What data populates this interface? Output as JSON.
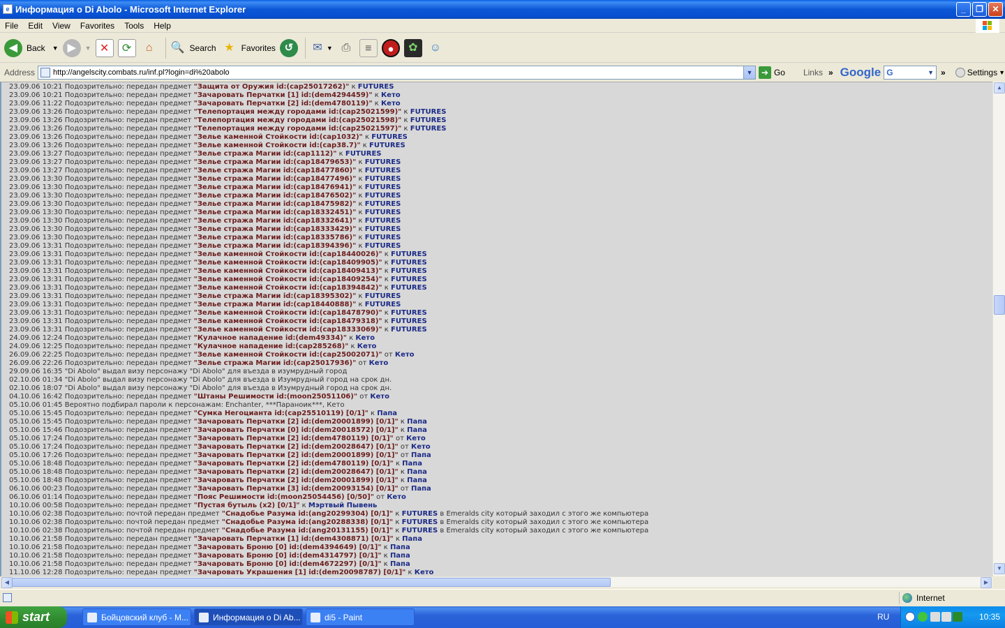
{
  "window": {
    "title": "Информация о Di Abolo - Microsoft Internet Explorer"
  },
  "menu": [
    "File",
    "Edit",
    "View",
    "Favorites",
    "Tools",
    "Help"
  ],
  "toolbar": {
    "back": "Back",
    "search": "Search",
    "favorites": "Favorites"
  },
  "address": {
    "label": "Address",
    "url": "http://angelscity.combats.ru/inf.pl?login=di%20abolo",
    "go": "Go",
    "links": "Links",
    "google": "Google",
    "settings": "Settings"
  },
  "log": [
    {
      "t": "23.09.06 10:21 Подозрительно: передан предмет ",
      "item": "Защита от Оружия id:(cap25017262)",
      "dir": " к ",
      "who": "FUTURES"
    },
    {
      "t": "23.09.06 10:21 Подозрительно: передан предмет ",
      "item": "Зачаровать Перчатки [1] id:(dem4294459)",
      "dir": " к ",
      "who": "Кето"
    },
    {
      "t": "23.09.06 11:22 Подозрительно: передан предмет ",
      "item": "Зачаровать Перчатки [2] id:(dem4780119)",
      "dir": " к ",
      "who": "Кето"
    },
    {
      "t": "23.09.06 13:26 Подозрительно: передан предмет ",
      "item": "Телепортация между городами id:(cap25021599)",
      "dir": " к ",
      "who": "FUTURES"
    },
    {
      "t": "23.09.06 13:26 Подозрительно: передан предмет ",
      "item": "Телепортация между городами id:(cap25021598)",
      "dir": " к ",
      "who": "FUTURES"
    },
    {
      "t": "23.09.06 13:26 Подозрительно: передан предмет ",
      "item": "Телепортация между городами id:(cap25021597)",
      "dir": " к ",
      "who": "FUTURES"
    },
    {
      "t": "23.09.06 13:26 Подозрительно: передан предмет ",
      "item": "Зелье каменной Стойкости id:(cap1032)",
      "dir": " к ",
      "who": "FUTURES"
    },
    {
      "t": "23.09.06 13:26 Подозрительно: передан предмет ",
      "item": "Зелье каменной Стойкости id:(cap38.7)",
      "dir": " к ",
      "who": "FUTURES"
    },
    {
      "t": "23.09.06 13:27 Подозрительно: передан предмет ",
      "item": "Зелье стража Магии id:(cap1112)",
      "dir": " к ",
      "who": "FUTURES"
    },
    {
      "t": "23.09.06 13:27 Подозрительно: передан предмет ",
      "item": "Зелье стража Магии id:(cap18479653)",
      "dir": " к ",
      "who": "FUTURES"
    },
    {
      "t": "23.09.06 13:27 Подозрительно: передан предмет ",
      "item": "Зелье стража Магии id:(cap18477860)",
      "dir": " к ",
      "who": "FUTURES"
    },
    {
      "t": "23.09.06 13:30 Подозрительно: передан предмет ",
      "item": "Зелье стража Магии id:(cap18477496)",
      "dir": " к ",
      "who": "FUTURES"
    },
    {
      "t": "23.09.06 13:30 Подозрительно: передан предмет ",
      "item": "Зелье стража Магии id:(cap18476941)",
      "dir": " к ",
      "who": "FUTURES"
    },
    {
      "t": "23.09.06 13:30 Подозрительно: передан предмет ",
      "item": "Зелье стража Магии id:(cap18476502)",
      "dir": " к ",
      "who": "FUTURES"
    },
    {
      "t": "23.09.06 13:30 Подозрительно: передан предмет ",
      "item": "Зелье стража Магии id:(cap18475982)",
      "dir": " к ",
      "who": "FUTURES"
    },
    {
      "t": "23.09.06 13:30 Подозрительно: передан предмет ",
      "item": "Зелье стража Магии id:(cap18332451)",
      "dir": " к ",
      "who": "FUTURES"
    },
    {
      "t": "23.09.06 13:30 Подозрительно: передан предмет ",
      "item": "Зелье стража Магии id:(cap18332641)",
      "dir": " к ",
      "who": "FUTURES"
    },
    {
      "t": "23.09.06 13:30 Подозрительно: передан предмет ",
      "item": "Зелье стража Магии id:(cap18333429)",
      "dir": " к ",
      "who": "FUTURES"
    },
    {
      "t": "23.09.06 13:30 Подозрительно: передан предмет ",
      "item": "Зелье стража Магии id:(cap18335786)",
      "dir": " к ",
      "who": "FUTURES"
    },
    {
      "t": "23.09.06 13:31 Подозрительно: передан предмет ",
      "item": "Зелье стража Магии id:(cap18394396)",
      "dir": " к ",
      "who": "FUTURES"
    },
    {
      "t": "23.09.06 13:31 Подозрительно: передан предмет ",
      "item": "Зелье каменной Стойкости id:(cap18440026)",
      "dir": " к ",
      "who": "FUTURES"
    },
    {
      "t": "23.09.06 13:31 Подозрительно: передан предмет ",
      "item": "Зелье каменной Стойкости id:(cap18409905)",
      "dir": " к ",
      "who": "FUTURES"
    },
    {
      "t": "23.09.06 13:31 Подозрительно: передан предмет ",
      "item": "Зелье каменной Стойкости id:(cap18409413)",
      "dir": " к ",
      "who": "FUTURES"
    },
    {
      "t": "23.09.06 13:31 Подозрительно: передан предмет ",
      "item": "Зелье каменной Стойкости id:(cap18409254)",
      "dir": " к ",
      "who": "FUTURES"
    },
    {
      "t": "23.09.06 13:31 Подозрительно: передан предмет ",
      "item": "Зелье каменной Стойкости id:(cap18394842)",
      "dir": " к ",
      "who": "FUTURES"
    },
    {
      "t": "23.09.06 13:31 Подозрительно: передан предмет ",
      "item": "Зелье стража Магии id:(cap18395302)",
      "dir": " к ",
      "who": "FUTURES"
    },
    {
      "t": "23.09.06 13:31 Подозрительно: передан предмет ",
      "item": "Зелье стража Магии id:(cap18440888)",
      "dir": " к ",
      "who": "FUTURES"
    },
    {
      "t": "23.09.06 13:31 Подозрительно: передан предмет ",
      "item": "Зелье каменной Стойкости id:(cap18478790)",
      "dir": " к ",
      "who": "FUTURES"
    },
    {
      "t": "23.09.06 13:31 Подозрительно: передан предмет ",
      "item": "Зелье каменной Стойкости id:(cap18479318)",
      "dir": " к ",
      "who": "FUTURES"
    },
    {
      "t": "23.09.06 13:31 Подозрительно: передан предмет ",
      "item": "Зелье каменной Стойкости id:(cap18333069)",
      "dir": " к ",
      "who": "FUTURES"
    },
    {
      "t": "24.09.06 12:24 Подозрительно: передан предмет ",
      "item": "Кулачное нападение id:(dem49334)",
      "dir": " к ",
      "who": "Кето"
    },
    {
      "t": "24.09.06 12:25 Подозрительно: передан предмет ",
      "item": "Кулачное нападение id:(cap285268)",
      "dir": " к ",
      "who": "Кето"
    },
    {
      "t": "26.09.06 22:25 Подозрительно: передан предмет ",
      "item": "Зелье каменной Стойкости id:(cap25002071)",
      "dir": " от ",
      "who": "Кето"
    },
    {
      "t": "26.09.06 22:26 Подозрительно: передан предмет ",
      "item": "Зелье стража Магии id:(cap25017936)",
      "dir": " от ",
      "who": "Кето"
    },
    {
      "t": "29.09.06 16:35 \"Di Abolo\" выдал визу персонажу \"Di Abolo\" для въезда в изумрудный город"
    },
    {
      "t": "02.10.06 01:34 \"Di Abolo\" выдал визу персонажу \"Di Abolo\" для въезда в Изумрудный город на срок дн."
    },
    {
      "t": "02.10.06 18:07 \"Di Abolo\" выдал визу персонажу \"Di Abolo\" для въезда в Изумрудный город на срок дн."
    },
    {
      "t": "04.10.06 16:42 Подозрительно: передан предмет ",
      "item": "Штаны Решимости id:(moon25051106)",
      "dir": " от ",
      "who": "Кето"
    },
    {
      "t": "05.10.06 01:45 Вероятно подбирал пароли к персонажам: Enchanter, ***Параноик***, Кето"
    },
    {
      "t": "05.10.06 15:45 Подозрительно: передан предмет ",
      "item": "Сумка Негоцианта id:(cap25510119) [0/1]",
      "dir": " к ",
      "who": "Папа"
    },
    {
      "t": "05.10.06 15:45 Подозрительно: передан предмет ",
      "item": "Зачаровать Перчатки [2] id:(dem20001899) [0/1]",
      "dir": " к ",
      "who": "Папа"
    },
    {
      "t": "05.10.06 15:46 Подозрительно: передан предмет ",
      "item": "Зачаровать Перчатки [0] id:(dem20018572) [0/1]",
      "dir": " к ",
      "who": "Папа"
    },
    {
      "t": "05.10.06 17:24 Подозрительно: передан предмет ",
      "item": "Зачаровать Перчатки [2] id:(dem4780119) [0/1]",
      "dir": " от ",
      "who": "Кето"
    },
    {
      "t": "05.10.06 17:24 Подозрительно: передан предмет ",
      "item": "Зачаровать Перчатки [2] id:(dem20028647) [0/1]",
      "dir": " от ",
      "who": "Кето"
    },
    {
      "t": "05.10.06 17:26 Подозрительно: передан предмет ",
      "item": "Зачаровать Перчатки [2] id:(dem20001899) [0/1]",
      "dir": " от ",
      "who": "Папа"
    },
    {
      "t": "05.10.06 18:48 Подозрительно: передан предмет ",
      "item": "Зачаровать Перчатки [2] id:(dem4780119) [0/1]",
      "dir": " к ",
      "who": "Папа"
    },
    {
      "t": "05.10.06 18:48 Подозрительно: передан предмет ",
      "item": "Зачаровать Перчатки [2] id:(dem20028647) [0/1]",
      "dir": " к ",
      "who": "Папа"
    },
    {
      "t": "05.10.06 18:48 Подозрительно: передан предмет ",
      "item": "Зачаровать Перчатки [2] id:(dem20001899) [0/1]",
      "dir": " к ",
      "who": "Папа"
    },
    {
      "t": "06.10.06 00:23 Подозрительно: передан предмет ",
      "item": "Зачаровать Перчатки [3] id:(dem20093154) [0/1]",
      "dir": " от ",
      "who": "Папа"
    },
    {
      "t": "06.10.06 01:14 Подозрительно: передан предмет ",
      "item": "Пояс Решимости id:(moon25054456) [0/50]",
      "dir": " от ",
      "who": "Кето"
    },
    {
      "t": "10.10.06 00:58 Подозрительно: передан предмет ",
      "item": "Пустая бутыль (x2) [0/1]",
      "dir": " к ",
      "who": "Мэртвый Пывень"
    },
    {
      "t": "10.10.06 02:38 Подозрительно: почтой передан предмет ",
      "item": "Снадобье Разума id:(ang20299304) [0/1]",
      "dir": " к ",
      "who": "FUTURES",
      "tail": " в Emeralds city который заходил с этого же компьютера"
    },
    {
      "t": "10.10.06 02:38 Подозрительно: почтой передан предмет ",
      "item": "Снадобье Разума id:(ang20288338) [0/1]",
      "dir": " к ",
      "who": "FUTURES",
      "tail": " в Emeralds city который заходил с этого же компьютера"
    },
    {
      "t": "10.10.06 02:38 Подозрительно: почтой передан предмет ",
      "item": "Снадобье Разума id:(ang20131155) [0/1]",
      "dir": " к ",
      "who": "FUTURES",
      "tail": " в Emeralds city который заходил с этого же компьютера"
    },
    {
      "t": "10.10.06 21:58 Подозрительно: передан предмет ",
      "item": "Зачаровать Перчатки [1] id:(dem4308871) [0/1]",
      "dir": " к ",
      "who": "Папа"
    },
    {
      "t": "10.10.06 21:58 Подозрительно: передан предмет ",
      "item": "Зачаровать Броню [0] id:(dem4394649) [0/1]",
      "dir": " к ",
      "who": "Папа"
    },
    {
      "t": "10.10.06 21:58 Подозрительно: передан предмет ",
      "item": "Зачаровать Броню [0] id:(dem4314797) [0/1]",
      "dir": " к ",
      "who": "Папа"
    },
    {
      "t": "10.10.06 21:58 Подозрительно: передан предмет ",
      "item": "Зачаровать Броню [0] id:(dem4672297) [0/1]",
      "dir": " к ",
      "who": "Папа"
    },
    {
      "t": "11.10.06 12:28 Подозрительно: передан предмет ",
      "item": "Зачаровать Украшения [1] id:(dem20098787) [0/1]",
      "dir": " к ",
      "who": "Кето"
    }
  ],
  "status": {
    "zone": "Internet"
  },
  "taskbar": {
    "start": "start",
    "tasks": [
      "Бойцовский клуб - M...",
      "Информация о Di Ab...",
      "di5 - Paint"
    ],
    "lang": "RU",
    "clock": "10:35"
  }
}
